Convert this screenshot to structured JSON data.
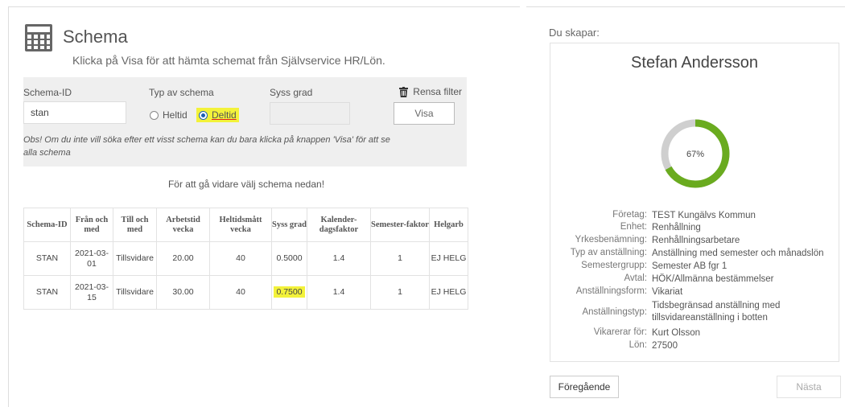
{
  "header": {
    "icon": "calculator-icon",
    "title": "Schema",
    "subtitle": "Klicka på Visa för att hämta schemat från Självservice HR/Lön."
  },
  "filters": {
    "schema_id_label": "Schema-ID",
    "schema_id_value": "stan",
    "type_label": "Typ av schema",
    "type_options": [
      "Heltid",
      "Deltid"
    ],
    "type_selected": "Deltid",
    "syss_grad_label": "Syss grad",
    "syss_grad_value": "",
    "clear_filter_label": "Rensa filter",
    "visa_label": "Visa",
    "note": "Obs! Om du inte vill söka efter ett visst schema kan du bara klicka på knappen 'Visa' för att se alla schema"
  },
  "instruction": "För att gå vidare välj schema nedan!",
  "table": {
    "columns": [
      "Schema-ID",
      "Från och med",
      "Till och med",
      "Arbetstid vecka",
      "Heltidsmått vecka",
      "Syss grad",
      "Kalender-dagsfaktor",
      "Semester-faktor",
      "Helgarb"
    ],
    "rows": [
      [
        "STAN",
        "2021-03-01",
        "Tillsvidare",
        "20.00",
        "40",
        "0.5000",
        "1.4",
        "1",
        "EJ HELG"
      ],
      [
        "STAN",
        "2021-03-15",
        "Tillsvidare",
        "30.00",
        "40",
        "0.7500",
        "1.4",
        "1",
        "EJ HELG"
      ]
    ],
    "highlighted_cell": {
      "row": 1,
      "col": 5
    }
  },
  "summary": {
    "heading": "Du skapar:",
    "name": "Stefan Andersson",
    "progress_percent": 67,
    "progress_label": "67%",
    "colors": {
      "progress": "#6aab1f",
      "track": "#cfcfcf",
      "highlight": "#f3f23a"
    },
    "details": [
      {
        "key": "Företag:",
        "value": "TEST Kungälvs Kommun"
      },
      {
        "key": "Enhet:",
        "value": "Renhållning"
      },
      {
        "key": "Yrkesbenämning:",
        "value": "Renhållningsarbetare"
      },
      {
        "key": "Typ av anställning:",
        "value": "Anställning med semester och månadslön"
      },
      {
        "key": "Semestergrupp:",
        "value": "Semester AB fgr 1"
      },
      {
        "key": "Avtal:",
        "value": "HÖK/Allmänna bestämmelser"
      },
      {
        "key": "Anställningsform:",
        "value": "Vikariat"
      },
      {
        "key": "Anställningstyp:",
        "value": "Tidsbegränsad anställning med tillsvidareanställning i botten"
      },
      {
        "key": "Vikarerar för:",
        "value": "Kurt Olsson"
      },
      {
        "key": "Lön:",
        "value": "27500"
      }
    ]
  },
  "nav": {
    "prev_label": "Föregående",
    "next_label": "Nästa"
  }
}
